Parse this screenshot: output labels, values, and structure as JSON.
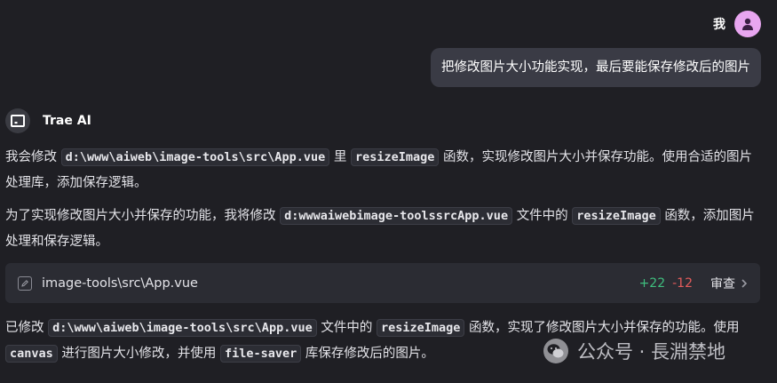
{
  "user": {
    "name": "我",
    "message": "把修改图片大小功能实现，最后要能保存修改后的图片"
  },
  "ai": {
    "name": "Trae AI"
  },
  "para1": {
    "t1": "我会修改",
    "c1": "d:\\www\\aiweb\\image-tools\\src\\App.vue",
    "t2": "里",
    "c2": "resizeImage",
    "t3": "函数，实现修改图片大小并保存功能。使用合适的图片处理库，添加保存逻辑。"
  },
  "para2": {
    "t1": "为了实现修改图片大小并保存的功能，我将修改",
    "c1": "d:wwwaiwebimage-toolssrcApp.vue",
    "t2": "文件中的",
    "c2": "resizeImage",
    "t3": "函数，添加图片处理和保存逻辑。"
  },
  "file_card": {
    "path": "image-tools\\src\\App.vue",
    "added": "+22",
    "removed": "-12",
    "review_label": "审查"
  },
  "para3": {
    "t1": "已修改",
    "c1": "d:\\www\\aiweb\\image-tools\\src\\App.vue",
    "t2": "文件中的",
    "c2": "resizeImage",
    "t3": "函数，实现了修改图片大小并保存的功能。使用",
    "c3": "canvas",
    "t4": "进行图片大小修改，并使用",
    "c4": "file-saver",
    "t5": "库保存修改后的图片。"
  },
  "watermark": {
    "text": "公众号 · 長淵禁地"
  },
  "colors": {
    "background": "#1f1f24",
    "user_bubble": "#3a3b45",
    "avatar": "#e8a6f0",
    "diff_add": "#3fbf7f",
    "diff_del": "#e35b5b"
  }
}
